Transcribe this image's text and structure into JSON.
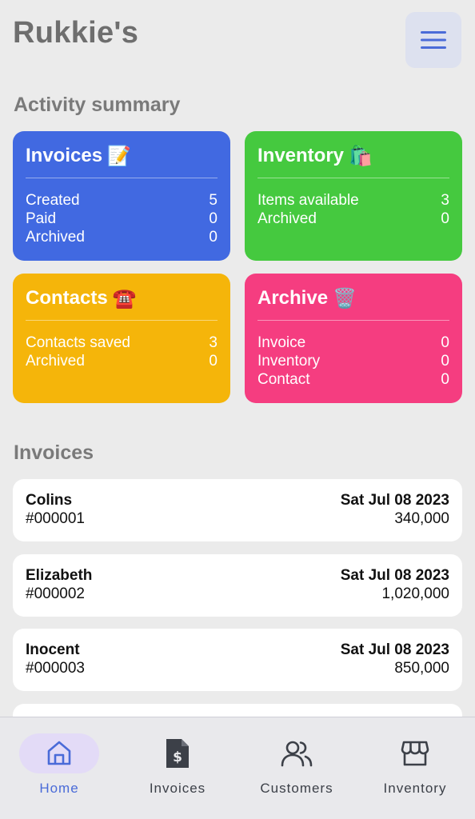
{
  "header": {
    "title": "Rukkie's"
  },
  "activity": {
    "title": "Activity summary",
    "cards": {
      "invoices": {
        "title": "Invoices",
        "emoji": "📝",
        "color": "#4169e1",
        "rows": [
          {
            "label": "Created",
            "value": "5"
          },
          {
            "label": "Paid",
            "value": "0"
          },
          {
            "label": "Archived",
            "value": "0"
          }
        ]
      },
      "inventory": {
        "title": "Inventory",
        "emoji": "🛍️",
        "color": "#45c93f",
        "rows": [
          {
            "label": "Items available",
            "value": "3"
          },
          {
            "label": "Archived",
            "value": "0"
          }
        ]
      },
      "contacts": {
        "title": "Contacts",
        "emoji": "☎️",
        "color": "#f5b50a",
        "rows": [
          {
            "label": "Contacts saved",
            "value": "3"
          },
          {
            "label": "Archived",
            "value": "0"
          }
        ]
      },
      "archive": {
        "title": "Archive",
        "emoji": "🗑️",
        "color": "#f53d80",
        "rows": [
          {
            "label": "Invoice",
            "value": "0"
          },
          {
            "label": "Inventory",
            "value": "0"
          },
          {
            "label": "Contact",
            "value": "0"
          }
        ]
      }
    }
  },
  "invoices_list": {
    "title": "Invoices",
    "items": [
      {
        "name": "Colins",
        "number": "#000001",
        "date": "Sat Jul 08 2023",
        "amount": "340,000"
      },
      {
        "name": "Elizabeth",
        "number": "#000002",
        "date": "Sat Jul 08 2023",
        "amount": "1,020,000"
      },
      {
        "name": "Inocent",
        "number": "#000003",
        "date": "Sat Jul 08 2023",
        "amount": "850,000"
      }
    ]
  },
  "nav": {
    "items": [
      {
        "label": "Home",
        "icon": "home-icon",
        "active": true
      },
      {
        "label": "Invoices",
        "icon": "invoice-icon"
      },
      {
        "label": "Customers",
        "icon": "users-icon"
      },
      {
        "label": "Inventory",
        "icon": "store-icon"
      }
    ],
    "active_color": "#4a6bd8",
    "active_bg": "#e3dbf7"
  }
}
